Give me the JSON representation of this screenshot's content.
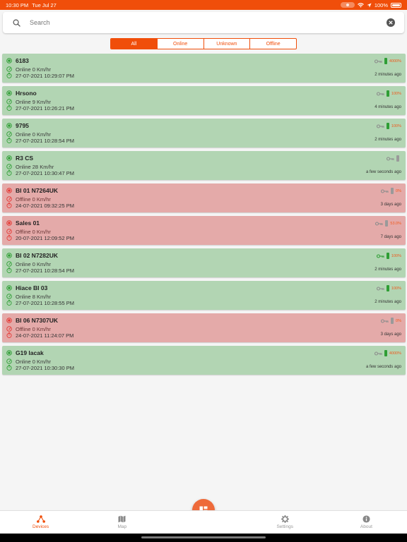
{
  "status_bar": {
    "time": "10:30 PM",
    "date": "Tue Jul 27",
    "battery_text": "100%"
  },
  "search": {
    "placeholder": "Search",
    "value": ""
  },
  "filters": {
    "tabs": [
      "All",
      "Online",
      "Unknown",
      "Offline"
    ],
    "active": "All"
  },
  "colors": {
    "accent": "#f04e0a",
    "online_card": "#b2d5b3",
    "offline_card": "#e4aaa9",
    "online_icon": "#2f9e35",
    "offline_icon": "#e53935"
  },
  "devices": [
    {
      "name": "6183",
      "status": "online",
      "speed_text": "Online 0 Km/hr",
      "timestamp": "27-07-2021 10:29:07 PM",
      "ago": "2 minutes ago",
      "battery_pct": "4000%",
      "key_active": false,
      "battery_present": true
    },
    {
      "name": "Hrsono",
      "status": "online",
      "speed_text": "Online 9 Km/hr",
      "timestamp": "27-07-2021 10:26:21 PM",
      "ago": "4 minutes ago",
      "battery_pct": "100%",
      "key_active": false,
      "battery_present": true
    },
    {
      "name": "9795",
      "status": "online",
      "speed_text": "Online 0 Km/hr",
      "timestamp": "27-07-2021 10:28:54 PM",
      "ago": "2 minutes ago",
      "battery_pct": "100%",
      "key_active": false,
      "battery_present": true
    },
    {
      "name": "R3 CS",
      "status": "online",
      "speed_text": "Online 28 Km/hr",
      "timestamp": "27-07-2021 10:30:47 PM",
      "ago": "a few seconds ago",
      "battery_pct": "",
      "key_active": false,
      "battery_present": false
    },
    {
      "name": "BI 01 N7264UK",
      "status": "offline",
      "speed_text": "Offline 0 Km/hr",
      "timestamp": "24-07-2021 09:32:25 PM",
      "ago": "3 days ago",
      "battery_pct": "0%",
      "key_active": false,
      "battery_present": false
    },
    {
      "name": "Sales 01",
      "status": "offline",
      "speed_text": "Offline 0 Km/hr",
      "timestamp": "20-07-2021 12:09:52 PM",
      "ago": "7 days ago",
      "battery_pct": "53.0%",
      "key_active": false,
      "battery_present": false
    },
    {
      "name": "BI 02 N7282UK",
      "status": "online",
      "speed_text": "Online 0 Km/hr",
      "timestamp": "27-07-2021 10:28:54 PM",
      "ago": "2 minutes ago",
      "battery_pct": "100%",
      "key_active": true,
      "battery_present": true
    },
    {
      "name": "Hiace BI 03",
      "status": "online",
      "speed_text": "Online 8 Km/hr",
      "timestamp": "27-07-2021 10:28:55 PM",
      "ago": "2 minutes ago",
      "battery_pct": "100%",
      "key_active": false,
      "battery_present": true
    },
    {
      "name": "BI 06 N7307UK",
      "status": "offline",
      "speed_text": "Offline 0 Km/hr",
      "timestamp": "24-07-2021 11:24:07 PM",
      "ago": "3 days ago",
      "battery_pct": "0%",
      "key_active": false,
      "battery_present": false
    },
    {
      "name": "G19 lacak",
      "status": "online",
      "speed_text": "Online 0 Km/hr",
      "timestamp": "27-07-2021 10:30:30 PM",
      "ago": "a few seconds ago",
      "battery_pct": "4000%",
      "key_active": false,
      "battery_present": true
    }
  ],
  "bottom_nav": {
    "items": [
      {
        "label": "Devices",
        "icon": "devices-icon",
        "active": true
      },
      {
        "label": "Map",
        "icon": "map-icon",
        "active": false
      },
      {
        "label": "Settings",
        "icon": "gear-icon",
        "active": false
      },
      {
        "label": "About",
        "icon": "info-icon",
        "active": false
      }
    ]
  }
}
